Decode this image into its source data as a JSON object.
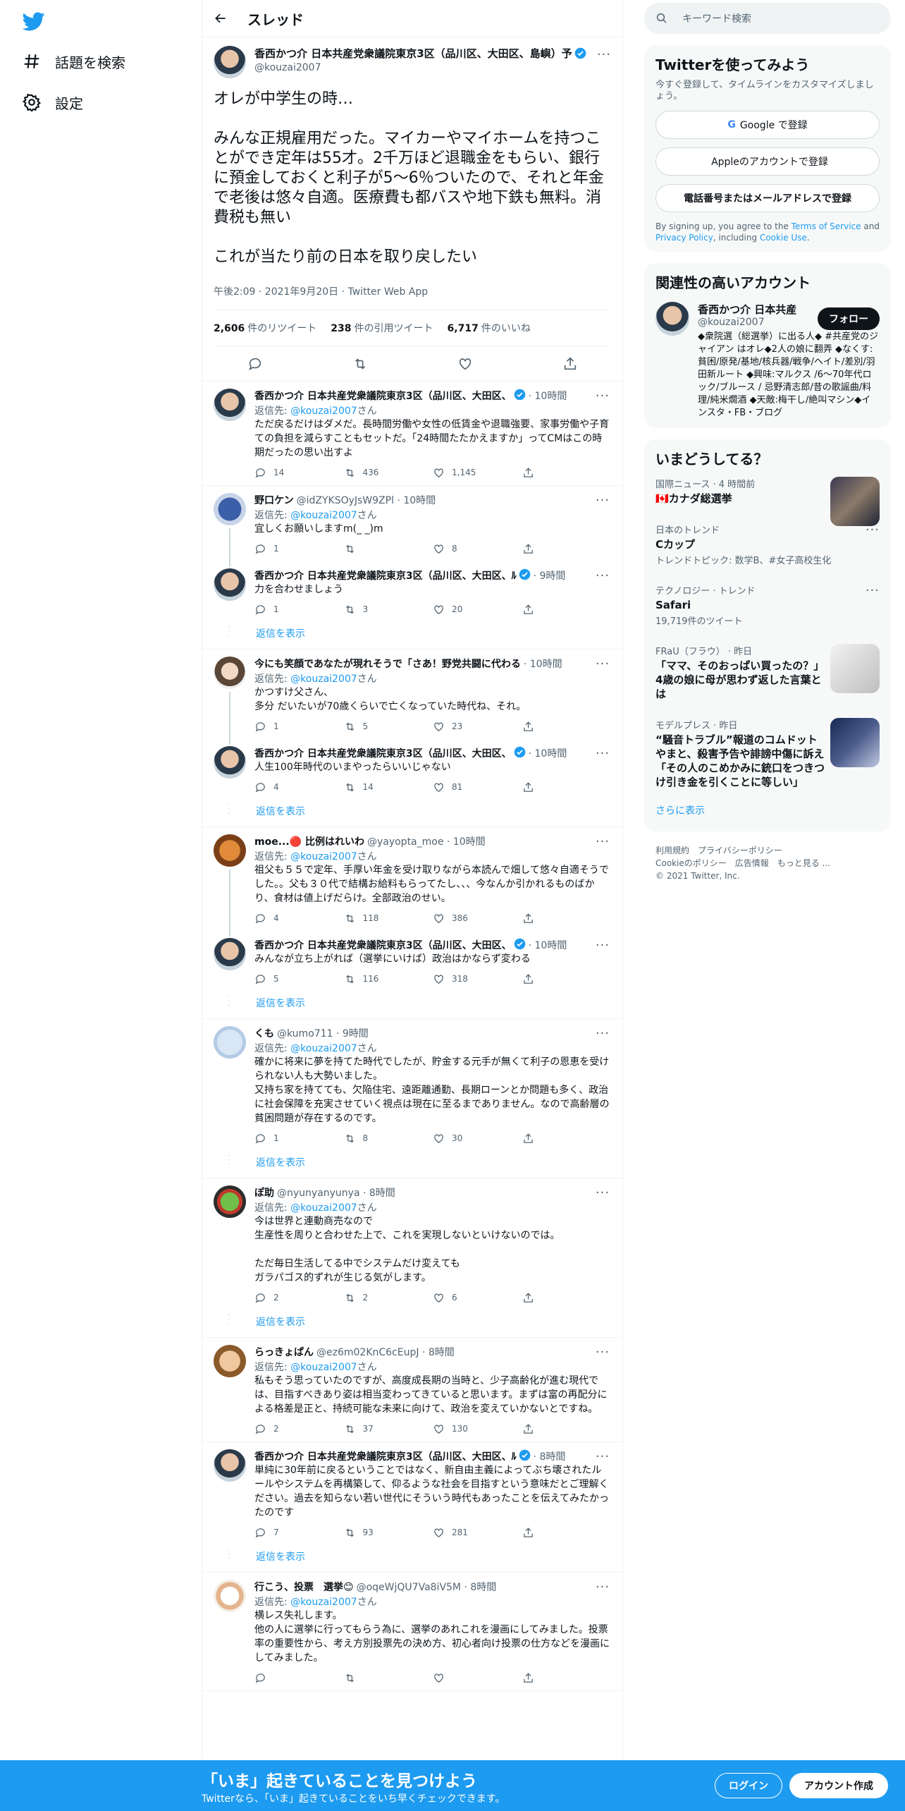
{
  "nav": {
    "explore": "話題を検索",
    "settings": "設定"
  },
  "thread": {
    "title": "スレッド",
    "main": {
      "name": "香西かつ介 日本共産党衆議院東京3区（品川区、大田区、島嶼）予",
      "handle": "@kouzai2007",
      "text": "オレが中学生の時…\n\nみんな正規雇用だった。マイカーやマイホームを持つことができ定年は55才。2千万ほど退職金をもらい、銀行に預金しておくと利子が5～6％ついたので、それと年金で老後は悠々自適。医療費も都バスや地下鉄も無料。消費税も無い\n\nこれが当たり前の日本を取り戻したい",
      "time": "午後2:09 · 2021年9月20日 · Twitter Web App",
      "retweets_num": "2,606",
      "retweets_label": "件のリツイート",
      "quotes_num": "238",
      "quotes_label": "件の引用ツイート",
      "likes_num": "6,717",
      "likes_label": "件のいいね"
    },
    "replying_prefix": "返信先:",
    "replying_handle": "@kouzai2007",
    "replying_suffix": "さん",
    "show_more": "返信を表示",
    "replies": [
      {
        "name": "香西かつ介 日本共産党衆議院東京3区（品川区、大田区、",
        "meta": "· 10時間",
        "verified": true,
        "replyto": true,
        "text": "ただ戻るだけはダメだ。長時間労働や女性の低賃金や退職強要、家事労働や子育ての負担を減らすこともセットだ。「24時間たたかえますか」ってCMはこの時期だったの思い出すよ",
        "r": "14",
        "rt": "436",
        "l": "1,145"
      },
      {
        "name": "野口ケン",
        "meta": "@idZYKSOyJsW9ZPl · 10時間",
        "verified": false,
        "replyto": true,
        "text": "宜しくお願いしますm(_ _)m",
        "r": "1",
        "rt": "",
        "l": "8"
      },
      {
        "name": "香西かつ介 日本共産党衆議院東京3区（品川区、大田区、ﾙ",
        "meta": "· 9時間",
        "verified": true,
        "replyto": false,
        "text": "力を合わせましょう",
        "r": "1",
        "rt": "3",
        "l": "20"
      },
      {
        "name": "今にも笑顔であなたが現れそうで「さあ！野党共闘に代わる",
        "meta": "· 10時間",
        "verified": false,
        "replyto": true,
        "text": "かつすけ父さん、\n多分 だいたいが70歳くらいで亡くなっていた時代ね、それ。",
        "r": "1",
        "rt": "5",
        "l": "23"
      },
      {
        "name": "香西かつ介 日本共産党衆議院東京3区（品川区、大田区、",
        "meta": "· 10時間",
        "verified": true,
        "replyto": false,
        "text": "人生100年時代のいまやったらいいじゃない",
        "r": "4",
        "rt": "14",
        "l": "81"
      },
      {
        "name": "moe...🔴 比例はれいわ",
        "meta": "@yayopta_moe · 10時間",
        "verified": false,
        "replyto": true,
        "text": "祖父も５５で定年、手厚い年金を受け取りながら本読んで畑して悠々自適そうでした。。父も３０代で結構お給料もらってたし、、、今なんか引かれるものばかり、食材は値上げだらけ。全部政治のせい。",
        "r": "4",
        "rt": "118",
        "l": "386"
      },
      {
        "name": "香西かつ介 日本共産党衆議院東京3区（品川区、大田区、",
        "meta": "· 10時間",
        "verified": true,
        "replyto": false,
        "text": "みんなが立ち上がれば（選挙にいけば）政治はかならず変わる",
        "r": "5",
        "rt": "116",
        "l": "318"
      },
      {
        "name": "くも",
        "meta": "@kumo711 · 9時間",
        "verified": false,
        "replyto": true,
        "text": "確かに将来に夢を持てた時代でしたが、貯金する元手が無くて利子の恩恵を受けられない人も大勢いました。\n又持ち家を持てても、欠陥住宅、遠距離通勤、長期ローンとか問題も多く、政治に社会保障を充実させていく視点は現在に至るまでありません。なので高齢層の貧困問題が存在するのです。",
        "r": "1",
        "rt": "8",
        "l": "30"
      },
      {
        "name": "ぽ助",
        "meta": "@nyunyanyunya · 8時間",
        "verified": false,
        "replyto": true,
        "text": "今は世界と連動商売なので\n生産性を周りと合わせた上で、これを実現しないといけないのでは。\n\nただ毎日生活してる中でシステムだけ変えても\nガラパゴス的ずれが生じる気がします。",
        "r": "2",
        "rt": "2",
        "l": "6"
      },
      {
        "name": "らっきょぱん",
        "meta": "@ez6m02KnC6cEupJ · 8時間",
        "verified": false,
        "replyto": true,
        "text": "私もそう思っていたのですが、高度成長期の当時と、少子高齢化が進む現代では、目指すべきあり姿は相当変わってきていると思います。まずは富の再配分による格差是正と、持続可能な未来に向けて、政治を変えていかないとですね。",
        "r": "2",
        "rt": "37",
        "l": "130"
      },
      {
        "name": "香西かつ介 日本共産党衆議院東京3区（品川区、大田区、ﾙ",
        "meta": "· 8時間",
        "verified": true,
        "replyto": false,
        "text": "単純に30年前に戻るということではなく、新自由主義によってぶち壊されたルールやシステムを再構築して、仰るような社会を目指すという意味だとご理解ください。過去を知らない若い世代にそういう時代もあったことを伝えてみたかったのです",
        "r": "7",
        "rt": "93",
        "l": "281"
      },
      {
        "name": "行こう、投票　選挙😊",
        "meta": "@oqeWjQU7Va8iV5M · 8時間",
        "verified": false,
        "replyto": true,
        "text": "横レス失礼します。\n他の人に選挙に行ってもらう為に、選挙のあれこれを漫画にしてみました。投票率の重要性から、考え方別投票先の決め方、初心者向け投票の仕方などを漫画にしてみました。",
        "r": "",
        "rt": "",
        "l": ""
      }
    ]
  },
  "sidebar": {
    "search_placeholder": "キーワード検索",
    "signup": {
      "title": "Twitterを使ってみよう",
      "sub": "今すぐ登録して、タイムラインをカスタマイズしましょう。",
      "google": "Google で登録",
      "apple": "Appleのアカウントで登録",
      "phone": "電話番号またはメールアドレスで登録",
      "legal_1": "By signing up, you agree to the ",
      "terms": "Terms of Service",
      "legal_2": " and ",
      "privacy": "Privacy Policy",
      "legal_3": ", including ",
      "cookie": "Cookie Use",
      "legal_4": "."
    },
    "related": {
      "title": "関連性の高いアカウント",
      "name": "香西かつ介 日本共産",
      "handle": "@kouzai2007",
      "follow": "フォロー",
      "bio": "◆衆院選（総選挙）に出る人◆ #共産党のジャイアン はオレ◆2人の娘に翻弄 ◆なくす:貧困/原発/基地/核兵器/戦争/ヘイト/差別/羽田新ルート ◆興味:マルクス /6～70年代ロック/ブルース / 忌野清志郎/昔の歌謡曲/料理/純米燗酒 ◆天敵:梅干し/絶叫マシン◆インスタ・FB・ブログ"
    },
    "trends": {
      "title": "いまどうしてる？",
      "items": [
        {
          "cat": "国際ニュース · 4 時間前",
          "title": "🇨🇦カナダ総選挙",
          "extra": ""
        },
        {
          "cat": "日本のトレンド",
          "title": "Cカップ",
          "extra": "トレンドトピック: 数学B、#女子高校生化"
        },
        {
          "cat": "テクノロジー · トレンド",
          "title": "Safari",
          "extra": "19,719件のツイート"
        },
        {
          "cat": "FRaU（フラウ） · 昨日",
          "title": "「ママ、そのおっぱい買ったの？」4歳の娘に母が思わず返した言葉とは",
          "extra": ""
        },
        {
          "cat": "モデルプレス · 昨日",
          "title": "“騒音トラブル”報道のコムドットやまと、殺害予告や誹謗中傷に訴え「その人のこめかみに銃口をつきつけ引き金を引くことに等しい」",
          "extra": ""
        }
      ],
      "show_more": "さらに表示"
    },
    "footer": {
      "line1": "利用規約　プライバシーポリシー",
      "line2": "Cookieのポリシー　広告情報　もっと見る ...",
      "line3": "© 2021 Twitter, Inc."
    }
  },
  "banner": {
    "title": "「いま」起きていることを見つけよう",
    "sub": "Twitterなら、「いま」起きていることをいち早くチェックできます。",
    "login": "ログイン",
    "signup": "アカウント作成"
  },
  "colors": {
    "accent": "#1d9bf0",
    "text": "#0f1419",
    "muted": "#536471"
  }
}
